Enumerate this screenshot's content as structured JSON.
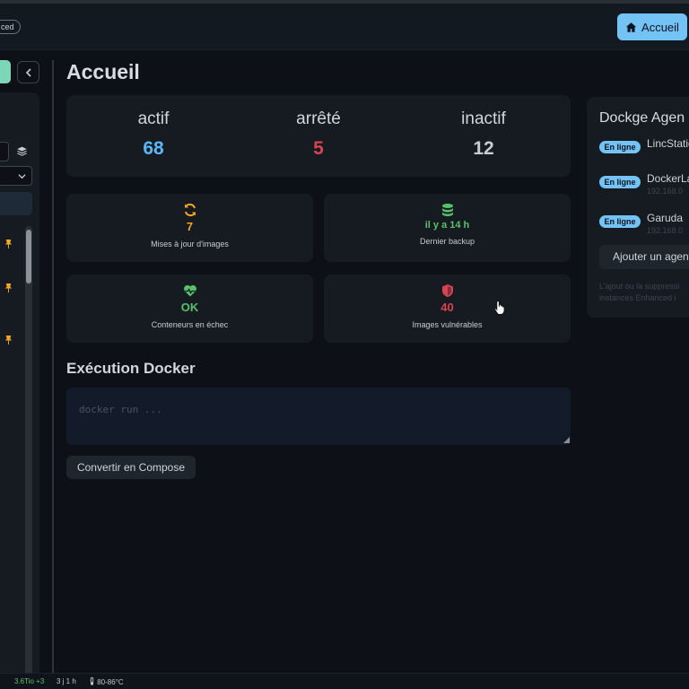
{
  "header": {
    "mode_badge": "ced",
    "home_label": "Accueil"
  },
  "page": {
    "title": "Accueil"
  },
  "stats": {
    "active_label": "actif",
    "active_value": "68",
    "stopped_label": "arrêté",
    "stopped_value": "5",
    "inactive_label": "inactif",
    "inactive_value": "12"
  },
  "cards": {
    "updates_value": "7",
    "updates_label": "Mises à jour d'images",
    "backup_value": "il y a 14 h",
    "backup_label": "Dernier backup",
    "failed_value": "OK",
    "failed_label": "Conteneurs en échec",
    "vuln_value": "40",
    "vuln_label": "Images vulnérables"
  },
  "docker_run": {
    "title": "Exécution Docker",
    "placeholder": "docker run ...",
    "convert_label": "Convertir en Compose"
  },
  "agents": {
    "title": "Dockge Agen",
    "items": [
      {
        "status": "En ligne",
        "name": "LincStatio",
        "ip": ""
      },
      {
        "status": "En ligne",
        "name": "DockerLa",
        "ip": "192.168.0"
      },
      {
        "status": "En ligne",
        "name": "Garuda",
        "ip": "192.168.0"
      }
    ],
    "add_label": "Ajouter un agent",
    "note_line1": "L'ajout ou la suppressi",
    "note_line2": "instances Enhanced i"
  },
  "statusbar": {
    "disk": "3.6Tio +3",
    "uptime": "3 j 1 h",
    "temp": "80-86°C"
  },
  "colors": {
    "accent": "#74c3f5",
    "active": "#5bb8f5",
    "stopped": "#d9434f",
    "inactive": "#c9cdd2",
    "warning": "#f5a623",
    "success": "#56c26a",
    "danger": "#d9434f"
  }
}
